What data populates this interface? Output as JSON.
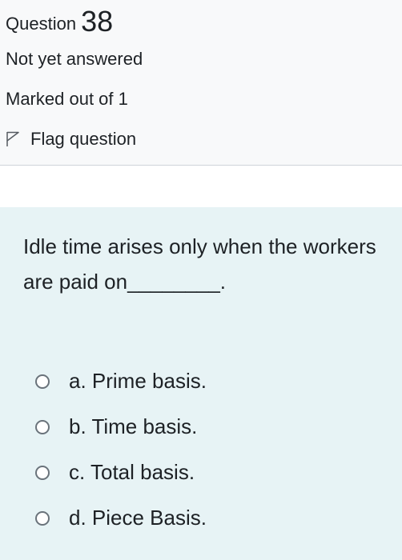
{
  "info": {
    "question_label": "Question",
    "question_number": "38",
    "state": "Not yet answered",
    "grade": "Marked out of 1",
    "flag_label": "Flag question",
    "flag_icon": "flag-outline-icon"
  },
  "question": {
    "text": "Idle time arises only when the workers are paid on________."
  },
  "answers": [
    {
      "label": "a. Prime basis."
    },
    {
      "label": "b. Time basis."
    },
    {
      "label": "c. Total basis."
    },
    {
      "label": "d. Piece Basis."
    }
  ],
  "colors": {
    "info_background": "#f8f9fa",
    "content_background": "#e7f3f5",
    "text": "#1d2125"
  }
}
